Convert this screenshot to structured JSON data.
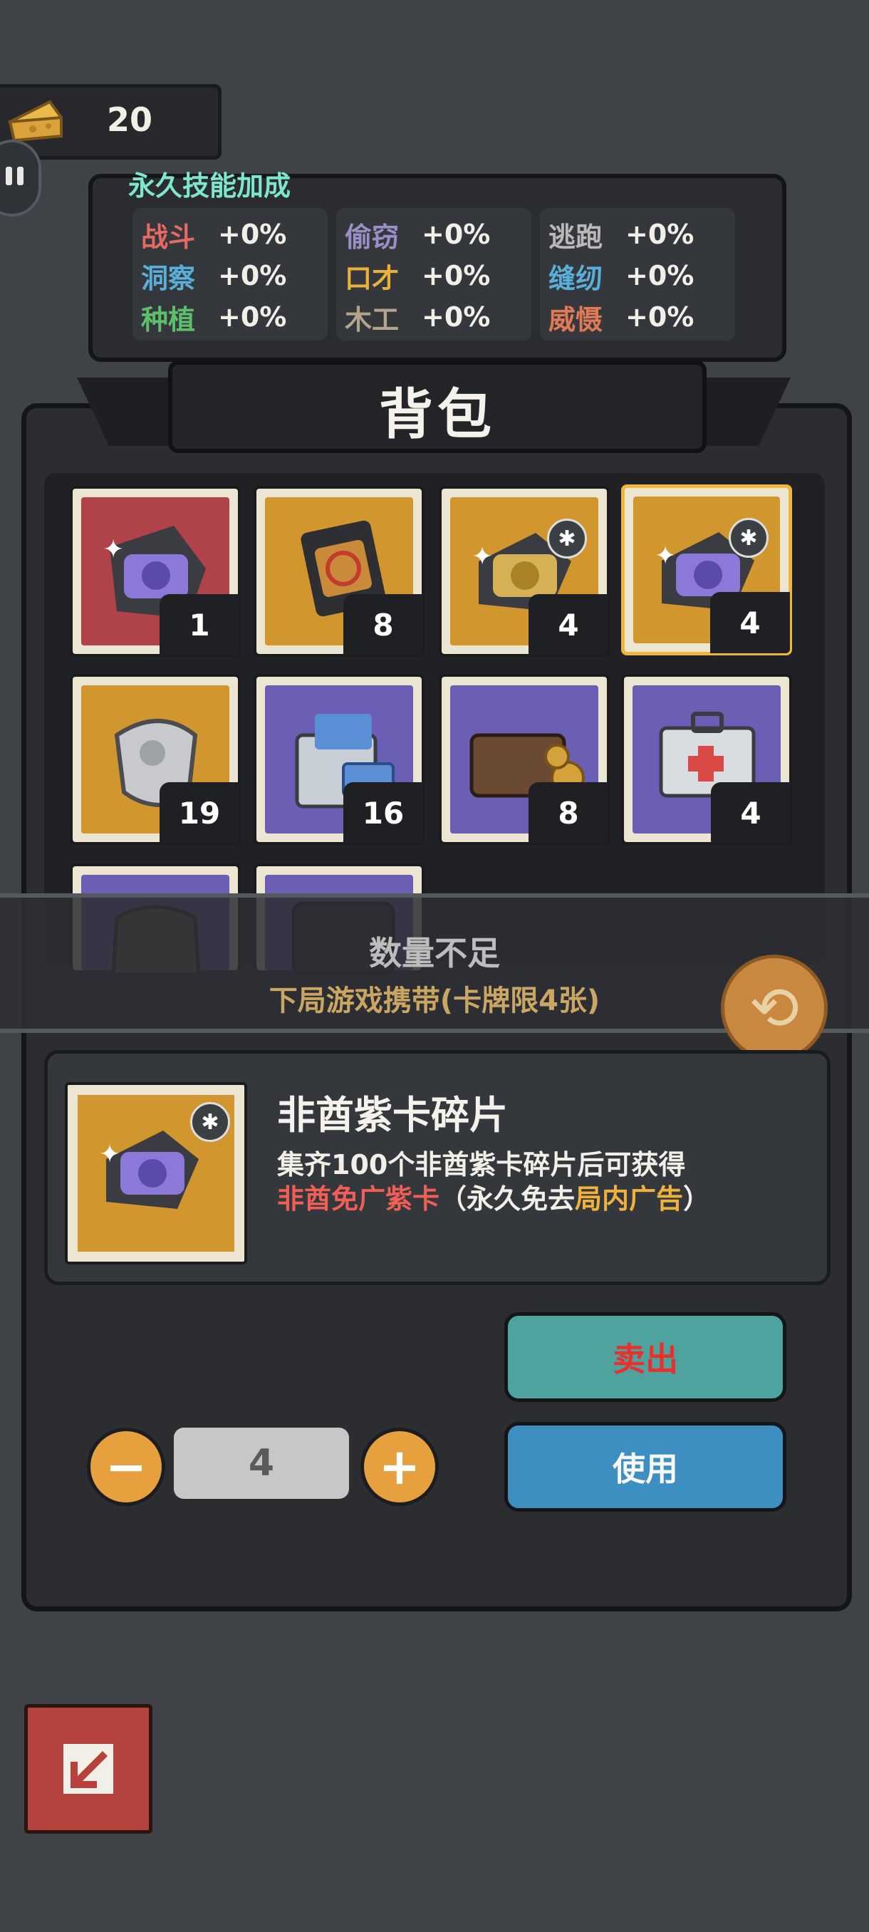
{
  "currency": {
    "icon": "cheese-icon",
    "value": "20"
  },
  "skills": {
    "title": "永久技能加成",
    "columns": [
      [
        {
          "name": "战斗",
          "value": "+0%",
          "color": "#e46a62"
        },
        {
          "name": "洞察",
          "value": "+0%",
          "color": "#5aaed8"
        },
        {
          "name": "种植",
          "value": "+0%",
          "color": "#5dbf6a"
        }
      ],
      [
        {
          "name": "偷窃",
          "value": "+0%",
          "color": "#9a8fc6"
        },
        {
          "name": "口才",
          "value": "+0%",
          "color": "#e9b03c"
        },
        {
          "name": "木工",
          "value": "+0%",
          "color": "#b4a48c"
        }
      ],
      [
        {
          "name": "逃跑",
          "value": "+0%",
          "color": "#b9b9b9"
        },
        {
          "name": "缝纫",
          "value": "+0%",
          "color": "#5aaed8"
        },
        {
          "name": "威慑",
          "value": "+0%",
          "color": "#e07a54"
        }
      ]
    ]
  },
  "backpack": {
    "title": "背包",
    "items": [
      {
        "count": "1",
        "bg": "#b0424a",
        "icon": "purple-card-pack-icon"
      },
      {
        "count": "8",
        "bg": "#d2962e",
        "icon": "sealed-card-pack-icon"
      },
      {
        "count": "4",
        "bg": "#d2962e",
        "icon": "gold-card-fragment-icon",
        "badge": "✱"
      },
      {
        "count": "4",
        "bg": "#d2962e",
        "icon": "purple-card-fragment-icon",
        "badge": "✱",
        "selected": true
      },
      {
        "count": "19",
        "bg": "#d2962e",
        "icon": "silver-mouse-token-icon"
      },
      {
        "count": "16",
        "bg": "#6a5fb4",
        "icon": "cash-bag-icon"
      },
      {
        "count": "8",
        "bg": "#6a5fb4",
        "icon": "wallet-icon"
      },
      {
        "count": "4",
        "bg": "#6a5fb4",
        "icon": "first-aid-kit-icon"
      },
      {
        "count": "",
        "bg": "#6a5fb4",
        "icon": "sack-icon"
      },
      {
        "count": "",
        "bg": "#6a5fb4",
        "icon": "dark-case-icon"
      }
    ]
  },
  "notice": {
    "line1": "数量不足",
    "line2": "下局游戏携带(卡牌限4张)"
  },
  "detail": {
    "name": "非酋紫卡碎片",
    "desc_line1": "集齐100个非酋紫卡碎片后可获得",
    "desc_red": "非酋免广紫卡",
    "desc_mid": "（永久免去",
    "desc_gold": "局内广告",
    "desc_end": "）"
  },
  "actions": {
    "sell": "卖出",
    "use": "使用",
    "minus": "−",
    "plus": "+",
    "quantity": "4"
  }
}
